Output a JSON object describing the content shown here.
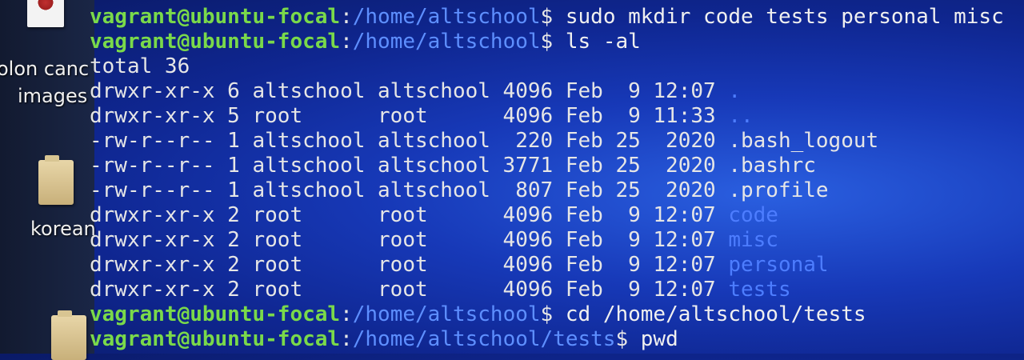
{
  "desktop": {
    "label_images": "images",
    "label_korean": "korean",
    "label_partial": "olon canc"
  },
  "prompt": {
    "user_host": "vagrant@ubuntu-focal",
    "colon": ":",
    "dollar": "$"
  },
  "lines": [
    {
      "type": "cmd",
      "path": "/home/altschool",
      "command": " sudo mkdir code tests personal misc"
    },
    {
      "type": "cmd",
      "path": "/home/altschool",
      "command": " ls -al"
    },
    {
      "type": "out",
      "text": "total 36"
    },
    {
      "type": "ls",
      "prefix": "drwxr-xr-x 6 altschool altschool 4096 Feb  9 12:07 ",
      "name": ".",
      "is_dir": true
    },
    {
      "type": "ls",
      "prefix": "drwxr-xr-x 5 root      root      4096 Feb  9 11:33 ",
      "name": "..",
      "is_dir": true
    },
    {
      "type": "ls",
      "prefix": "-rw-r--r-- 1 altschool altschool  220 Feb 25  2020 ",
      "name": ".bash_logout",
      "is_dir": false
    },
    {
      "type": "ls",
      "prefix": "-rw-r--r-- 1 altschool altschool 3771 Feb 25  2020 ",
      "name": ".bashrc",
      "is_dir": false
    },
    {
      "type": "ls",
      "prefix": "-rw-r--r-- 1 altschool altschool  807 Feb 25  2020 ",
      "name": ".profile",
      "is_dir": false
    },
    {
      "type": "ls",
      "prefix": "drwxr-xr-x 2 root      root      4096 Feb  9 12:07 ",
      "name": "code",
      "is_dir": true
    },
    {
      "type": "ls",
      "prefix": "drwxr-xr-x 2 root      root      4096 Feb  9 12:07 ",
      "name": "misc",
      "is_dir": true
    },
    {
      "type": "ls",
      "prefix": "drwxr-xr-x 2 root      root      4096 Feb  9 12:07 ",
      "name": "personal",
      "is_dir": true
    },
    {
      "type": "ls",
      "prefix": "drwxr-xr-x 2 root      root      4096 Feb  9 12:07 ",
      "name": "tests",
      "is_dir": true
    },
    {
      "type": "cmd",
      "path": "/home/altschool",
      "command": " cd /home/altschool/tests"
    },
    {
      "type": "cmd",
      "path": "/home/altschool/tests",
      "command": " pwd"
    }
  ]
}
